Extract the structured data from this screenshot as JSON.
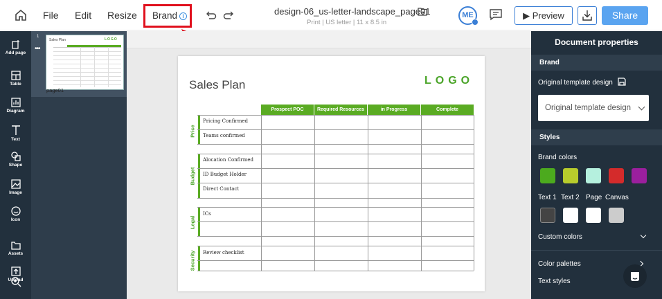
{
  "topbar": {
    "menu": [
      "File",
      "Edit",
      "Resize"
    ],
    "brand_label": "Brand",
    "doc_title": "design-06_us-letter-landscape_page01",
    "doc_subtitle": "Print | US letter | 11 x 8.5 in",
    "avatar_initials": "ME",
    "preview_label": "Preview",
    "share_label": "Share"
  },
  "leftbar": {
    "items": [
      "Add page",
      "Table",
      "Diagram",
      "Text",
      "Shape",
      "Image",
      "Icon",
      "Assets",
      "Upload"
    ]
  },
  "pages": {
    "thumb_number": "1",
    "thumb_label": "page01",
    "thumb_title": "Sales Plan",
    "thumb_logo": "LOGO"
  },
  "document": {
    "title": "Sales Plan",
    "logo": "LOGO",
    "columns": [
      "Prospect POC",
      "Required Resources",
      "in Progress",
      "Complete"
    ],
    "sections": [
      {
        "name": "Price",
        "rows": [
          "Pricing Confirmed",
          "Teams confirmed"
        ]
      },
      {
        "name": "Budget",
        "rows": [
          "Alocation Confirmed",
          "ID Budget Holder",
          "Direct Contact"
        ]
      },
      {
        "name": "Legal",
        "rows": [
          "ICs"
        ]
      },
      {
        "name": "Security",
        "rows": [
          "Review checklist"
        ]
      }
    ]
  },
  "properties": {
    "title": "Document properties",
    "brand_section": "Brand",
    "template_label": "Original template design",
    "template_value": "Original template design",
    "styles_section": "Styles",
    "brand_colors_label": "Brand colors",
    "brand_colors": [
      "#4caa1e",
      "#b8cc2c",
      "#b5f0de",
      "#d42b2b",
      "#9b1f9e"
    ],
    "text_color_labels": [
      "Text 1",
      "Text 2",
      "Page",
      "Canvas"
    ],
    "text_colors": [
      "#444444",
      "#ffffff",
      "#ffffff",
      "#cccccc"
    ],
    "custom_colors_label": "Custom colors",
    "color_palettes_label": "Color palettes",
    "text_styles_label": "Text styles"
  }
}
